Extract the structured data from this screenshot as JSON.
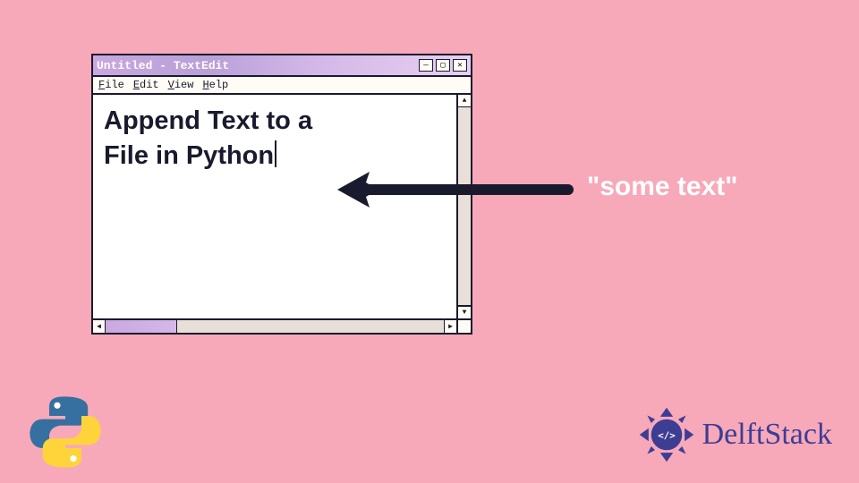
{
  "window": {
    "title": "Untitled - TextEdit",
    "menu": {
      "file": "File",
      "edit": "Edit",
      "view": "View",
      "help": "Help"
    },
    "content_line1": "Append Text to a",
    "content_line2": "File in Python"
  },
  "annotation": {
    "label": "\"some text\""
  },
  "branding": {
    "delft": "DelftStack"
  },
  "colors": {
    "background": "#f7a9b9",
    "frame": "#1a1a2e",
    "paper": "#fffcf5",
    "accent_purple": "#c9a8e0",
    "brand_blue": "#3d3d94"
  }
}
